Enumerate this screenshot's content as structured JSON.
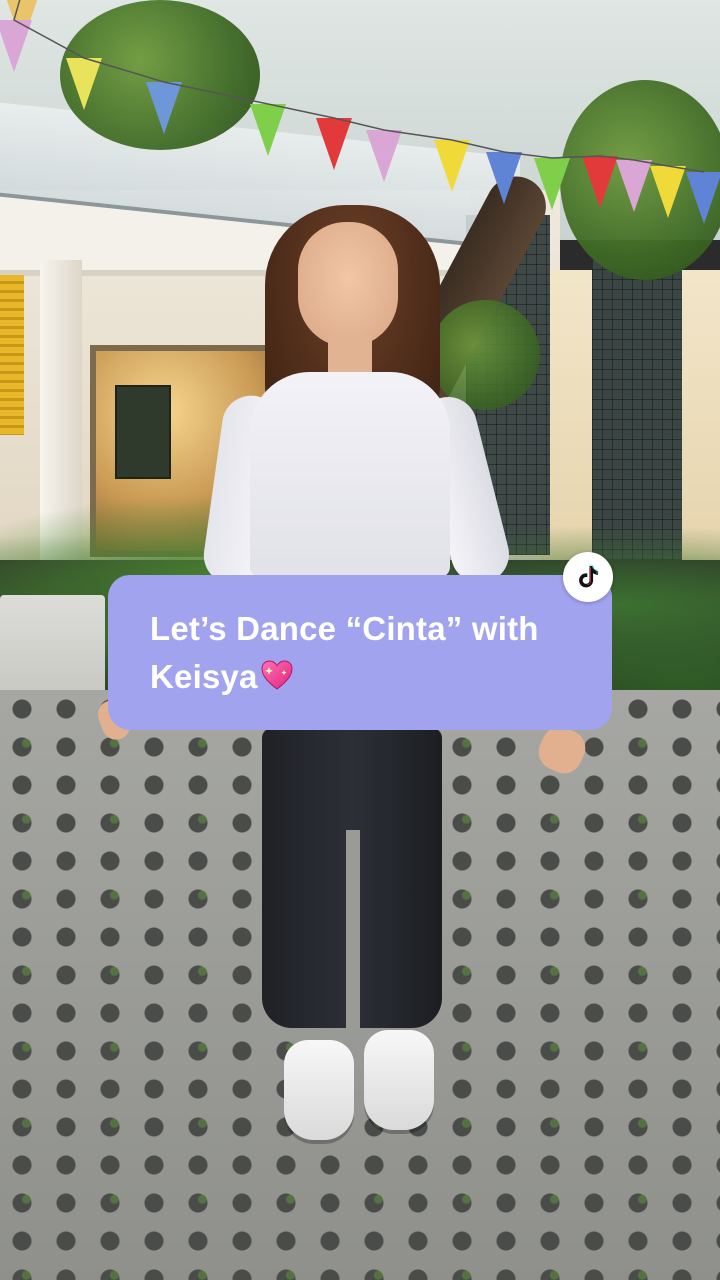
{
  "caption": {
    "line1": "Let’s Dance “Cinta” with",
    "line2": "Keisya",
    "emoji_icon": "sparkling-heart-icon",
    "background_color": "#a2a3ef",
    "text_color": "#ffffff"
  },
  "platform_badge": {
    "icon": "tiktok-logo-icon",
    "background_color": "#ffffff"
  },
  "bunting_colors": [
    "#e9c46a",
    "#d9a6d6",
    "#e8e35a",
    "#6d97d8",
    "#7fcf4a",
    "#e23a3a",
    "#d9a6d6",
    "#f0da3a",
    "#5f84d6",
    "#7fcf4a",
    "#e23a3a",
    "#d9a6d6",
    "#f0da3a",
    "#5f84d6"
  ]
}
